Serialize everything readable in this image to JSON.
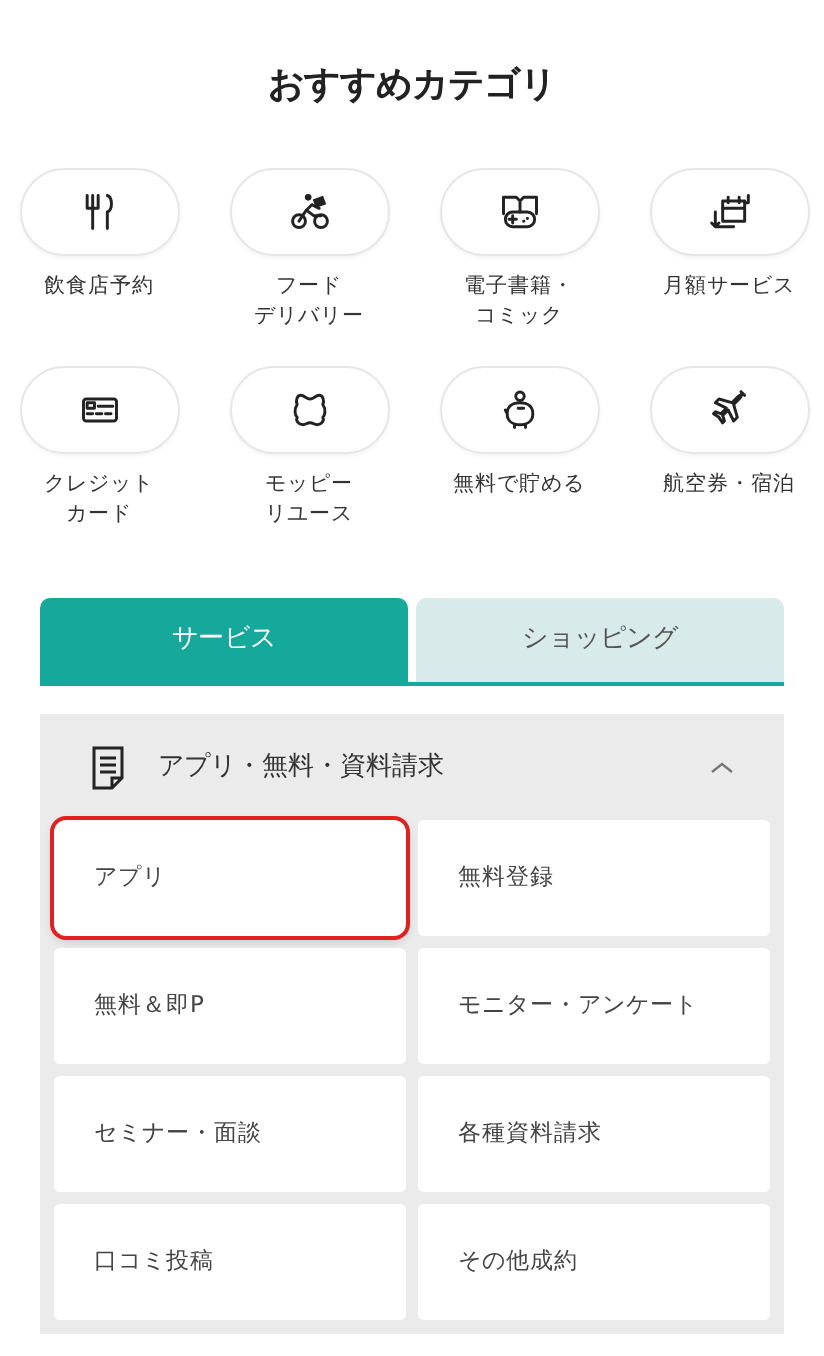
{
  "heading": "おすすめカテゴリ",
  "categories": [
    {
      "label_lines": [
        "飲食店予約"
      ]
    },
    {
      "label_lines": [
        "フード",
        "デリバリー"
      ]
    },
    {
      "label_lines": [
        "電子書籍・",
        "コミック"
      ]
    },
    {
      "label_lines": [
        "月額サービス"
      ]
    },
    {
      "label_lines": [
        "クレジット",
        "カード"
      ]
    },
    {
      "label_lines": [
        "モッピー",
        "リユース"
      ]
    },
    {
      "label_lines": [
        "無料で貯める"
      ]
    },
    {
      "label_lines": [
        "航空券・宿泊"
      ]
    }
  ],
  "tabs": [
    {
      "label": "サービス",
      "selected": true
    },
    {
      "label": "ショッピング",
      "selected": false
    }
  ],
  "section": {
    "title": "アプリ・無料・資料請求",
    "expanded": true,
    "items": [
      {
        "label": "アプリ",
        "selected": true
      },
      {
        "label": "無料登録",
        "selected": false
      },
      {
        "label": "無料＆即P",
        "selected": false
      },
      {
        "label": "モニター・アンケート",
        "selected": false
      },
      {
        "label": "セミナー・面談",
        "selected": false
      },
      {
        "label": "各種資料請求",
        "selected": false
      },
      {
        "label": "口コミ投稿",
        "selected": false
      },
      {
        "label": "その他成約",
        "selected": false
      }
    ]
  }
}
